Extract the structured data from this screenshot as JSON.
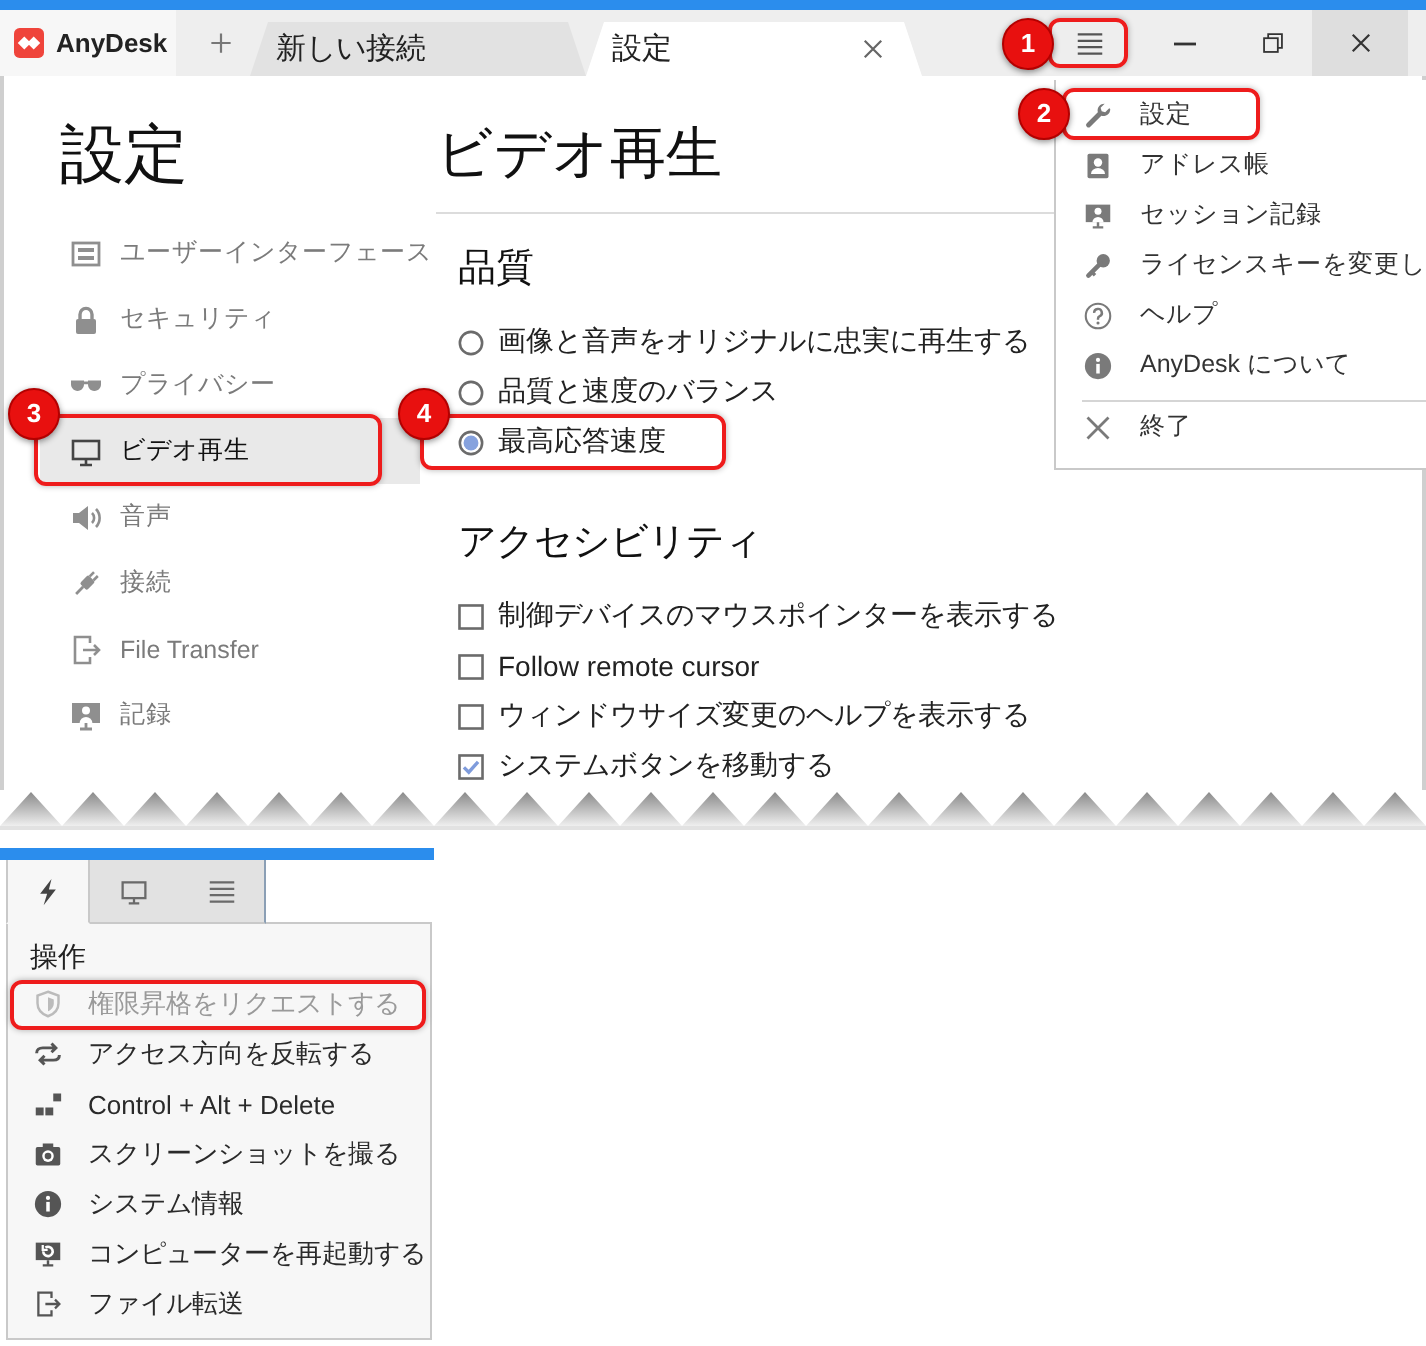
{
  "title_bar": {
    "app_name": "AnyDesk",
    "tabs": [
      {
        "label": "新しい接続",
        "selected": false
      },
      {
        "label": "設定",
        "selected": true
      }
    ],
    "menu_button": {
      "highlighted": true,
      "step": "1"
    }
  },
  "settings": {
    "title": "設定",
    "nav": [
      {
        "label": "ユーザーインターフェース",
        "selected": false,
        "highlighted": false
      },
      {
        "label": "セキュリティ",
        "selected": false,
        "highlighted": false
      },
      {
        "label": "プライバシー",
        "selected": false,
        "highlighted": false
      },
      {
        "label": "ビデオ再生",
        "selected": true,
        "highlighted": true,
        "step": "3"
      },
      {
        "label": "音声",
        "selected": false,
        "highlighted": false
      },
      {
        "label": "接続",
        "selected": false,
        "highlighted": false
      },
      {
        "label": "File Transfer",
        "selected": false,
        "highlighted": false
      },
      {
        "label": "記録",
        "selected": false,
        "highlighted": false
      }
    ]
  },
  "page": {
    "title": "ビデオ再生",
    "sections": [
      {
        "heading": "品質",
        "options": [
          {
            "kind": "radio",
            "label": "画像と音声をオリジナルに忠実に再生する",
            "selected": false,
            "highlighted": false
          },
          {
            "kind": "radio",
            "label": "品質と速度のバランス",
            "selected": false,
            "highlighted": false
          },
          {
            "kind": "radio",
            "label": "最高応答速度",
            "selected": true,
            "highlighted": true,
            "step": "4"
          }
        ]
      },
      {
        "heading": "アクセシビリティ",
        "options": [
          {
            "kind": "checkbox",
            "label": "制御デバイスのマウスポインターを表示する",
            "checked": false
          },
          {
            "kind": "checkbox",
            "label": "Follow remote cursor",
            "checked": false
          },
          {
            "kind": "checkbox",
            "label": "ウィンドウサイズ変更のヘルプを表示する",
            "checked": false
          },
          {
            "kind": "checkbox",
            "label": "システムボタンを移動する",
            "checked": true
          }
        ]
      }
    ]
  },
  "main_menu": {
    "items": [
      {
        "label": "設定",
        "highlighted": true,
        "step": "2",
        "separator_before": false
      },
      {
        "label": "アドレス帳",
        "highlighted": false,
        "separator_before": false
      },
      {
        "label": "セッション記録",
        "highlighted": false,
        "separator_before": false
      },
      {
        "label": "ライセンスキーを変更し",
        "highlighted": false,
        "separator_before": false
      },
      {
        "label": "ヘルプ",
        "highlighted": false,
        "separator_before": false
      },
      {
        "label": "AnyDesk について",
        "highlighted": false,
        "separator_before": false
      },
      {
        "label": "終了",
        "highlighted": false,
        "separator_before": true
      }
    ]
  },
  "session_panel": {
    "tabs": [
      {
        "selected": true
      },
      {
        "selected": false
      },
      {
        "selected": false
      }
    ],
    "section_title": "操作",
    "actions": [
      {
        "label": "権限昇格をリクエストする",
        "disabled": true,
        "highlighted": true
      },
      {
        "label": "アクセス方向を反転する",
        "disabled": false,
        "highlighted": false
      },
      {
        "label": "Control + Alt + Delete",
        "disabled": false,
        "highlighted": false
      },
      {
        "label": "スクリーンショットを撮る",
        "disabled": false,
        "highlighted": false
      },
      {
        "label": "システム情報",
        "disabled": false,
        "highlighted": false
      },
      {
        "label": "コンピューターを再起動する",
        "disabled": false,
        "highlighted": false
      },
      {
        "label": "ファイル転送",
        "disabled": false,
        "highlighted": false
      }
    ]
  }
}
